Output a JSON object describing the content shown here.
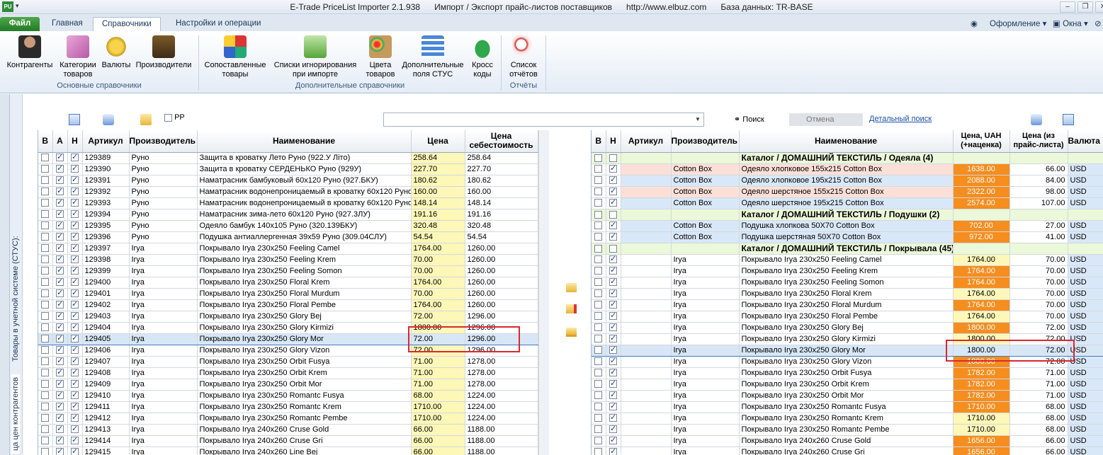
{
  "window": {
    "app_icon": "PU",
    "title_parts": [
      "E-Trade PriceList Importer 2.1.938",
      "Импорт / Экспорт прайс-листов поставщиков",
      "http://www.elbuz.com",
      "База данных: TR-BASE"
    ]
  },
  "tabs": {
    "file": "Файл",
    "main": "Главная",
    "refs": "Справочники",
    "settings": "Настройки и операции"
  },
  "right_menu": {
    "design": "Оформление",
    "windows": "Окна"
  },
  "ribbon": {
    "contractors": "Контрагенты",
    "categories": "Категории\nтоваров",
    "currencies": "Валюты",
    "manufacturers": "Производители",
    "group_main": "Основные справочники",
    "matched": "Сопоставленные\nтовары",
    "ignore_lists": "Списки игнорирования\nпри импорте",
    "colors": "Цвета\nтоваров",
    "extra_fields": "Дополнительные\nполя СТУС",
    "cross_codes": "Кросс\nкоды",
    "group_extra": "Дополнительные справочники",
    "reports_list": "Список\nотчётов",
    "group_reports": "Отчёты"
  },
  "side": {
    "vertical_label_1": "Товары в учетной системе (СТУС):",
    "vertical_label_2": "ца цен контрагентов"
  },
  "toolbar": {
    "pp_label": "РР",
    "search": "Поиск",
    "cancel": "Отмена",
    "detailed_search": "Детальный поиск"
  },
  "left_grid": {
    "headers": [
      "В",
      "А",
      "Н",
      "Артикул",
      "Производитель",
      "Наименование",
      "Цена",
      "Цена\nсебестоимость"
    ],
    "rows": [
      {
        "a": "129389",
        "m": "Руно",
        "n": "Защита в кроватку Лето Руно (922.У Літо)",
        "p": "258.64",
        "c": "258.64",
        "A": true,
        "N": true
      },
      {
        "a": "129390",
        "m": "Руно",
        "n": "Защита в кроватку СЕРДЕНЬКО Руно (929У)",
        "p": "227.70",
        "c": "227.70",
        "A": true,
        "N": true
      },
      {
        "a": "129391",
        "m": "Руно",
        "n": "Наматрасник бамбуковый 60х120 Руно (927.БКУ)",
        "p": "180.62",
        "c": "180.62",
        "A": true,
        "N": true
      },
      {
        "a": "129392",
        "m": "Руно",
        "n": "Наматрасник водонепроницаемый в кроватку 60х120 Руно",
        "p": "160.00",
        "c": "160.00",
        "A": true,
        "N": true
      },
      {
        "a": "129393",
        "m": "Руно",
        "n": "Наматрасник водонепроницаемый в кроватку 60х120 Руно",
        "p": "148.14",
        "c": "148.14",
        "A": true,
        "N": true
      },
      {
        "a": "129394",
        "m": "Руно",
        "n": "Наматрасник зима-лето 60х120 Руно (927.3ЛУ)",
        "p": "191.16",
        "c": "191.16",
        "A": true,
        "N": true
      },
      {
        "a": "129395",
        "m": "Руно",
        "n": "Одеяло бамбук 140х105 Руно (320.139БКУ)",
        "p": "320.48",
        "c": "320.48",
        "A": true,
        "N": true
      },
      {
        "a": "129396",
        "m": "Руно",
        "n": "Подушка антиаллергенная 39х59 Руно (309.04СЛУ)",
        "p": "54.54",
        "c": "54.54",
        "A": true,
        "N": true
      },
      {
        "a": "129397",
        "m": "Irya",
        "n": "Покрывало Irya 230x250 Feeling Camel",
        "p": "1764.00",
        "c": "1260.00",
        "A": true,
        "N": true
      },
      {
        "a": "129398",
        "m": "Irya",
        "n": "Покрывало Irya 230x250 Feeling Krem",
        "p": "70.00",
        "c": "1260.00",
        "A": true,
        "N": true
      },
      {
        "a": "129399",
        "m": "Irya",
        "n": "Покрывало Irya 230x250 Feeling Somon",
        "p": "70.00",
        "c": "1260.00",
        "A": true,
        "N": true
      },
      {
        "a": "129400",
        "m": "Irya",
        "n": "Покрывало Irya 230x250 Floral Krem",
        "p": "1764.00",
        "c": "1260.00",
        "A": true,
        "N": true
      },
      {
        "a": "129401",
        "m": "Irya",
        "n": "Покрывало Irya 230x250 Floral Murdum",
        "p": "70.00",
        "c": "1260.00",
        "A": true,
        "N": true
      },
      {
        "a": "129402",
        "m": "Irya",
        "n": "Покрывало Irya 230x250 Floral Pembe",
        "p": "1764.00",
        "c": "1260.00",
        "A": true,
        "N": true
      },
      {
        "a": "129403",
        "m": "Irya",
        "n": "Покрывало Irya 230x250 Glory Bej",
        "p": "72.00",
        "c": "1296.00",
        "A": true,
        "N": true
      },
      {
        "a": "129404",
        "m": "Irya",
        "n": "Покрывало Irya 230x250 Glory Kirmizi",
        "p": "1800.00",
        "c": "1296.00",
        "A": true,
        "N": true
      },
      {
        "a": "129405",
        "m": "Irya",
        "n": "Покрывало Irya 230x250 Glory Mor",
        "p": "72.00",
        "c": "1296.00",
        "A": true,
        "N": true,
        "sel": true
      },
      {
        "a": "129406",
        "m": "Irya",
        "n": "Покрывало Irya 230x250 Glory Vizon",
        "p": "72.00",
        "c": "1296.00",
        "A": true,
        "N": true
      },
      {
        "a": "129407",
        "m": "Irya",
        "n": "Покрывало Irya 230x250 Orbit Fusya",
        "p": "71.00",
        "c": "1278.00",
        "A": true,
        "N": true
      },
      {
        "a": "129408",
        "m": "Irya",
        "n": "Покрывало Irya 230x250 Orbit Krem",
        "p": "71.00",
        "c": "1278.00",
        "A": true,
        "N": true
      },
      {
        "a": "129409",
        "m": "Irya",
        "n": "Покрывало Irya 230x250 Orbit Mor",
        "p": "71.00",
        "c": "1278.00",
        "A": true,
        "N": true
      },
      {
        "a": "129410",
        "m": "Irya",
        "n": "Покрывало Irya 230x250 Romantc Fusya",
        "p": "68.00",
        "c": "1224.00",
        "A": true,
        "N": true
      },
      {
        "a": "129411",
        "m": "Irya",
        "n": "Покрывало Irya 230x250 Romantc Krem",
        "p": "1710.00",
        "c": "1224.00",
        "A": true,
        "N": true
      },
      {
        "a": "129412",
        "m": "Irya",
        "n": "Покрывало Irya 230x250 Romantc Pembe",
        "p": "1710.00",
        "c": "1224.00",
        "A": true,
        "N": true
      },
      {
        "a": "129413",
        "m": "Irya",
        "n": "Покрывало Irya 240x260 Cruse Gold",
        "p": "66.00",
        "c": "1188.00",
        "A": true,
        "N": true
      },
      {
        "a": "129414",
        "m": "Irya",
        "n": "Покрывало Irya 240x260 Cruse Gri",
        "p": "66.00",
        "c": "1188.00",
        "A": true,
        "N": true
      },
      {
        "a": "129415",
        "m": "Irya",
        "n": "Покрывало Irya 240x260 Line Bej",
        "p": "66.00",
        "c": "1188.00",
        "A": true,
        "N": true
      }
    ]
  },
  "right_grid": {
    "headers": [
      "В",
      "Н",
      "Артикул",
      "Производитель",
      "Наименование",
      "Цена, UAH\n(+наценка)",
      "Цена (из\nпрайс-листа)",
      "Валюта"
    ],
    "rows": [
      {
        "cat": "Каталог / ДОМАШНИЙ ТЕКСТИЛЬ / Одеяла (4)"
      },
      {
        "m": "Cotton Box",
        "n": "Одеяло хлопковое 155х215 Cotton Box",
        "p": "1638.00",
        "pl": "66.00",
        "cur": "USD",
        "bg": "pink",
        "pc": "orange",
        "N": true
      },
      {
        "m": "Cotton Box",
        "n": "Одеяло хлопковое 195х215 Cotton Box",
        "p": "2088.00",
        "pl": "84.00",
        "cur": "USD",
        "bg": "blue",
        "pc": "orange",
        "N": true
      },
      {
        "m": "Cotton Box",
        "n": "Одеяло шерстяное 155х215 Cotton Box",
        "p": "2322.00",
        "pl": "98.00",
        "cur": "USD",
        "bg": "pink",
        "pc": "orange",
        "N": true
      },
      {
        "m": "Cotton Box",
        "n": "Одеяло шерстяное 195х215 Cotton Box",
        "p": "2574.00",
        "pl": "107.00",
        "cur": "USD",
        "bg": "blue",
        "pc": "orange",
        "N": true
      },
      {
        "cat": "Каталог / ДОМАШНИЙ ТЕКСТИЛЬ / Подушки (2)"
      },
      {
        "m": "Cotton Box",
        "n": "Подушка хлопкова 50Х70 Cotton Box",
        "p": "702.00",
        "pl": "27.00",
        "cur": "USD",
        "bg": "blue",
        "pc": "orange",
        "N": true
      },
      {
        "m": "Cotton Box",
        "n": "Подушка шерстяная 50Х70 Cotton Box",
        "p": "972.00",
        "pl": "41.00",
        "cur": "USD",
        "bg": "blue",
        "pc": "orange",
        "N": true
      },
      {
        "cat": "Каталог / ДОМАШНИЙ ТЕКСТИЛЬ / Покрывала (45)"
      },
      {
        "m": "Irya",
        "n": "Покрывало Irya 230x250 Feeling Camel",
        "p": "1764.00",
        "pl": "70.00",
        "cur": "USD",
        "pc": "yellow",
        "N": true
      },
      {
        "m": "Irya",
        "n": "Покрывало Irya 230x250 Feeling Krem",
        "p": "1764.00",
        "pl": "70.00",
        "cur": "USD",
        "pc": "orange",
        "N": true
      },
      {
        "m": "Irya",
        "n": "Покрывало Irya 230x250 Feeling Somon",
        "p": "1764.00",
        "pl": "70.00",
        "cur": "USD",
        "pc": "orange",
        "N": true
      },
      {
        "m": "Irya",
        "n": "Покрывало Irya 230x250 Floral Krem",
        "p": "1764.00",
        "pl": "70.00",
        "cur": "USD",
        "pc": "yellow",
        "N": true
      },
      {
        "m": "Irya",
        "n": "Покрывало Irya 230x250 Floral Murdum",
        "p": "1764.00",
        "pl": "70.00",
        "cur": "USD",
        "pc": "orange",
        "N": true
      },
      {
        "m": "Irya",
        "n": "Покрывало Irya 230x250 Floral Pembe",
        "p": "1764.00",
        "pl": "70.00",
        "cur": "USD",
        "pc": "yellow",
        "N": true
      },
      {
        "m": "Irya",
        "n": "Покрывало Irya 230x250 Glory Bej",
        "p": "1800.00",
        "pl": "72.00",
        "cur": "USD",
        "pc": "orange",
        "N": true
      },
      {
        "m": "Irya",
        "n": "Покрывало Irya 230x250 Glory Kirmizi",
        "p": "1800.00",
        "pl": "72.00",
        "cur": "USD",
        "pc": "yellow",
        "N": true
      },
      {
        "m": "Irya",
        "n": "Покрывало Irya 230x250 Glory Mor",
        "p": "1800.00",
        "pl": "72.00",
        "cur": "USD",
        "pc": "sel",
        "N": true,
        "sel": true
      },
      {
        "m": "Irya",
        "n": "Покрывало Irya 230x250 Glory Vizon",
        "p": "1800.00",
        "pl": "72.00",
        "cur": "USD",
        "pc": "orange",
        "N": true
      },
      {
        "m": "Irya",
        "n": "Покрывало Irya 230x250 Orbit Fusya",
        "p": "1782.00",
        "pl": "71.00",
        "cur": "USD",
        "pc": "orange",
        "N": true
      },
      {
        "m": "Irya",
        "n": "Покрывало Irya 230x250 Orbit Krem",
        "p": "1782.00",
        "pl": "71.00",
        "cur": "USD",
        "pc": "orange",
        "N": true
      },
      {
        "m": "Irya",
        "n": "Покрывало Irya 230x250 Orbit Mor",
        "p": "1782.00",
        "pl": "71.00",
        "cur": "USD",
        "pc": "orange",
        "N": true
      },
      {
        "m": "Irya",
        "n": "Покрывало Irya 230x250 Romantc Fusya",
        "p": "1710.00",
        "pl": "68.00",
        "cur": "USD",
        "pc": "orange",
        "N": true
      },
      {
        "m": "Irya",
        "n": "Покрывало Irya 230x250 Romantc Krem",
        "p": "1710.00",
        "pl": "68.00",
        "cur": "USD",
        "pc": "yellow",
        "N": true
      },
      {
        "m": "Irya",
        "n": "Покрывало Irya 230x250 Romantc Pembe",
        "p": "1710.00",
        "pl": "68.00",
        "cur": "USD",
        "pc": "yellow",
        "N": true
      },
      {
        "m": "Irya",
        "n": "Покрывало Irya 240x260 Cruse Gold",
        "p": "1656.00",
        "pl": "66.00",
        "cur": "USD",
        "pc": "orange",
        "N": true
      },
      {
        "m": "Irya",
        "n": "Покрывало Irya 240x260 Cruse Gri",
        "p": "1656.00",
        "pl": "66.00",
        "cur": "USD",
        "pc": "orange",
        "N": true
      }
    ]
  },
  "colors": {
    "accent_orange": "#f58d1f",
    "price_yellow": "#fdf7b8",
    "highlight_red": "#d9282e",
    "category_green": "#ebf8d9"
  }
}
